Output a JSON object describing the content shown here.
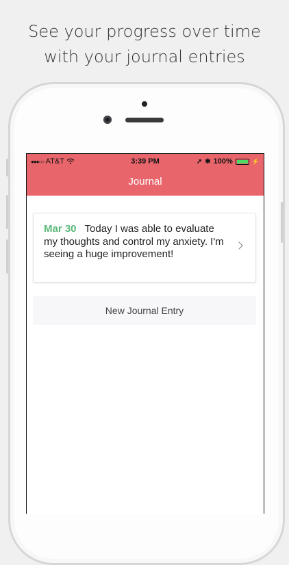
{
  "headline": {
    "line1": "See your progress over time",
    "line2": "with your journal entries"
  },
  "status_bar": {
    "signal": "●●●○○",
    "carrier": "AT&T",
    "wifi_icon": "wifi-icon",
    "time": "3:39 PM",
    "location_icon": "➚",
    "bluetooth_icon": "✱",
    "battery": "100%",
    "charging_icon": "⚡",
    "battery_color": "#4cd964"
  },
  "nav": {
    "title": "Journal",
    "color": "#e8666b"
  },
  "entries": [
    {
      "date": "Mar 30",
      "text": "Today I was able to evaluate my thoughts and control my anxiety. I'm seeing a huge improvement!",
      "date_color": "#5ab878"
    }
  ],
  "new_entry_label": "New Journal Entry"
}
